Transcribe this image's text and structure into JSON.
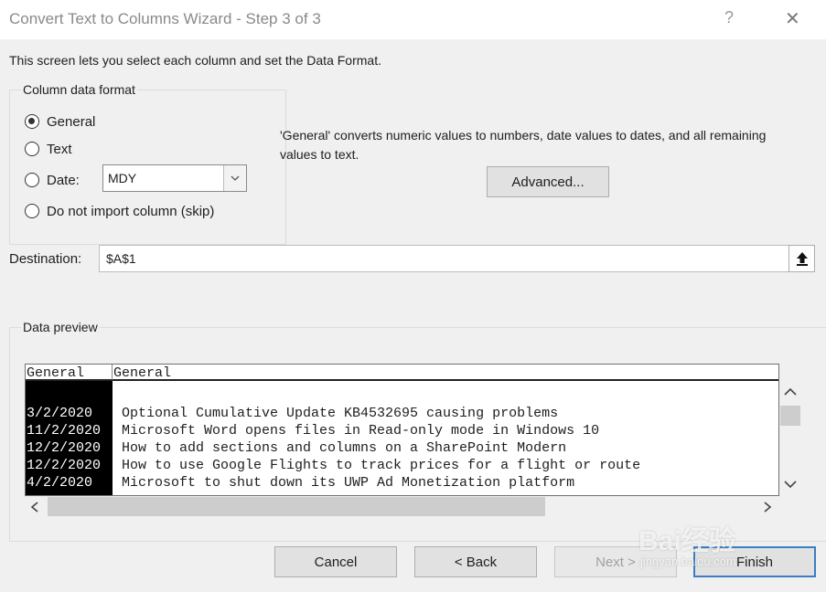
{
  "window": {
    "title": "Convert Text to Columns Wizard - Step 3 of 3",
    "help_label": "?",
    "close_label": "✕"
  },
  "instructions": "This screen lets you select each column and set the Data Format.",
  "column_format": {
    "legend": "Column data format",
    "options": [
      {
        "label": "General",
        "checked": true
      },
      {
        "label": "Text",
        "checked": false
      },
      {
        "label": "Date:",
        "checked": false
      },
      {
        "label": "Do not import column (skip)",
        "checked": false
      }
    ],
    "date_select": {
      "value": "MDY",
      "arrow_icon": "chevron-down-icon"
    }
  },
  "description": "'General' converts numeric values to numbers, date values to dates, and all remaining values to text.",
  "advanced_button": "Advanced...",
  "destination": {
    "label": "Destination:",
    "value": "$A$1",
    "collapse_icon": "collapse-dialog-icon"
  },
  "preview": {
    "legend": "Data preview",
    "headers": [
      "General",
      "General"
    ],
    "rows": [
      [
        "3/2/2020",
        "Optional Cumulative Update KB4532695 causing problems"
      ],
      [
        "11/2/2020",
        "Microsoft Word opens files in Read-only mode in Windows 10"
      ],
      [
        "12/2/2020",
        "How to add sections and columns on a SharePoint Modern"
      ],
      [
        "12/2/2020",
        "How to use Google Flights to track prices for a flight or route"
      ],
      [
        "4/2/2020",
        "Microsoft to shut down its UWP Ad Monetization platform"
      ]
    ],
    "vertical_scroll_position": 0.2
  },
  "buttons": {
    "cancel": "Cancel",
    "back": "< Back",
    "next": "Next >",
    "finish": "Finish"
  },
  "watermark": {
    "brand": "Bai经验",
    "url": "jingyan.baidu.com"
  },
  "colors": {
    "selected_column": "#000000",
    "default_button_border": "#3c7fc0"
  }
}
